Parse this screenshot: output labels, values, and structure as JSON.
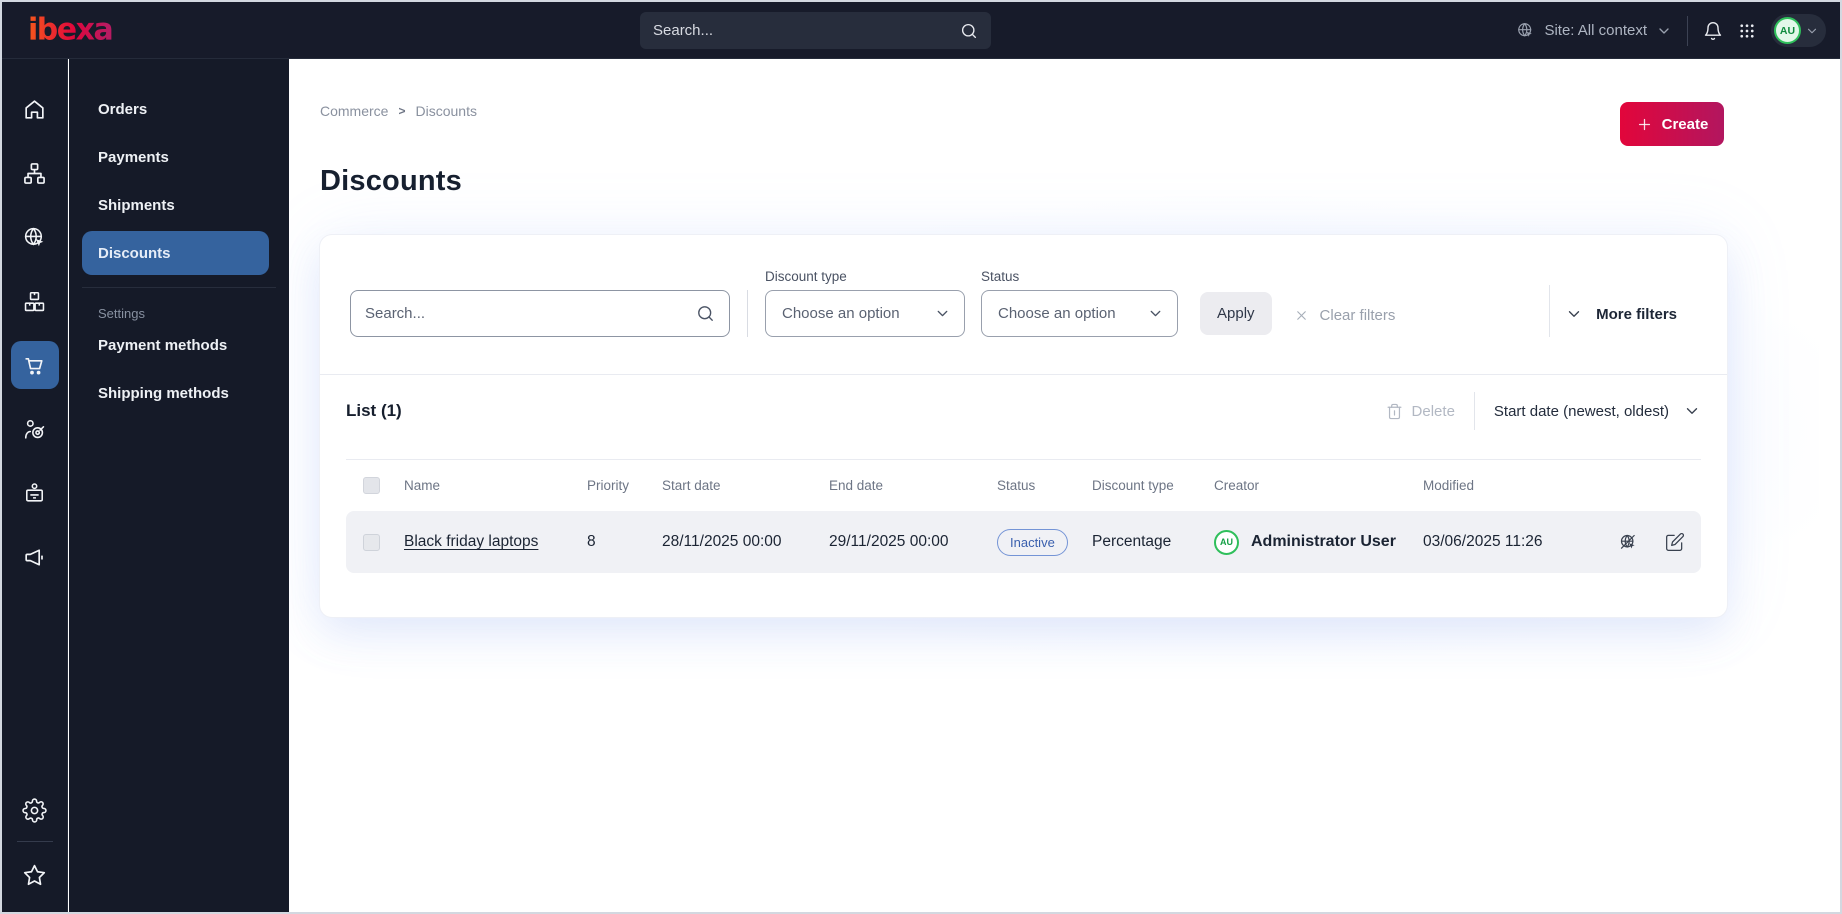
{
  "topbar": {
    "logo_text": "ibexa",
    "search_placeholder": "Search...",
    "site_context_label": "Site: All context",
    "avatar_initials": "AU"
  },
  "sidebar": {
    "rail_icons": [
      "home",
      "content-tree",
      "site",
      "products",
      "commerce",
      "customers",
      "company",
      "marketing"
    ],
    "rail_bottom_icons": [
      "settings",
      "bookmarks"
    ],
    "active_icon": "commerce",
    "menu": {
      "items": [
        {
          "label": "Orders",
          "active": false
        },
        {
          "label": "Payments",
          "active": false
        },
        {
          "label": "Shipments",
          "active": false
        },
        {
          "label": "Discounts",
          "active": true
        }
      ],
      "section_label": "Settings",
      "settings_items": [
        {
          "label": "Payment methods"
        },
        {
          "label": "Shipping methods"
        }
      ]
    }
  },
  "breadcrumb": {
    "items": [
      "Commerce",
      "Discounts"
    ],
    "separator": ">"
  },
  "page": {
    "title": "Discounts",
    "create_label": "Create"
  },
  "filters": {
    "search_placeholder": "Search...",
    "discount_type": {
      "label": "Discount type",
      "value": "Choose an option"
    },
    "status": {
      "label": "Status",
      "value": "Choose an option"
    },
    "apply_label": "Apply",
    "clear_label": "Clear filters",
    "more_filters_label": "More filters"
  },
  "list": {
    "title": "List (1)",
    "delete_label": "Delete",
    "sort_label": "Start date (newest, oldest)",
    "columns": [
      "Name",
      "Priority",
      "Start date",
      "End date",
      "Status",
      "Discount type",
      "Creator",
      "Modified"
    ],
    "rows": [
      {
        "name": "Black friday laptops",
        "priority": "8",
        "start_date": "28/11/2025 00:00",
        "end_date": "29/11/2025 00:00",
        "status": "Inactive",
        "discount_type": "Percentage",
        "creator": "Administrator User",
        "creator_initials": "AU",
        "modified": "03/06/2025 11:26"
      }
    ]
  },
  "icons": {
    "search": "magnifier",
    "site": "globe with cursor",
    "bell": "notification bell",
    "app-grid": "3x3 dot grid",
    "chevron-down": "v chevron",
    "plus": "plus sign",
    "clear": "x cross",
    "trash": "trash can",
    "preview-disabled": "slashed globe with cursor",
    "edit": "pencil in square"
  },
  "colors": {
    "accent-start": "#e2063b",
    "accent-end": "#b2165f",
    "selected-blue": "#35639e",
    "topbar-bg": "#171b2a",
    "sidebar-bg": "#151a28",
    "badge-blue": "#3a60ae",
    "badge-border": "#7494d6",
    "avatar-green": "#2fbf5b",
    "row-bg": "#f0f1f5"
  }
}
